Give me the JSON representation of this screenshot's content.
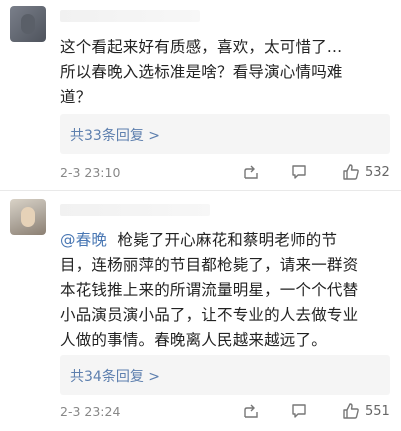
{
  "comments": [
    {
      "username": "",
      "text_lines": [
        "这个看起来好有质感，喜欢，太可惜了...",
        "所以春晚入选标准是啥？看导演心情吗难",
        "道？"
      ],
      "reply_label": "共33条回复 >",
      "time": "2-3 23:10",
      "likes": "532"
    },
    {
      "username": "",
      "mention": "@春晚",
      "text_first_rest": "  枪毙了开心麻花和蔡明老师的节",
      "text_lines": [
        "目，连杨丽萍的节目都枪毙了，请来一群资",
        "本花钱推上来的所谓流量明星，一个个代替",
        "小品演员演小品了，让不专业的人去做专业",
        "人做的事情。春晚离人民越来越远了。"
      ],
      "reply_label": "共34条回复 >",
      "time": "2-3 23:24",
      "likes": "551"
    }
  ],
  "icons": [
    "share-icon",
    "comment-icon",
    "like-icon"
  ],
  "colors": {
    "mention": "#4a78b4",
    "reply_link": "#5d7fae",
    "meta": "#888888"
  }
}
